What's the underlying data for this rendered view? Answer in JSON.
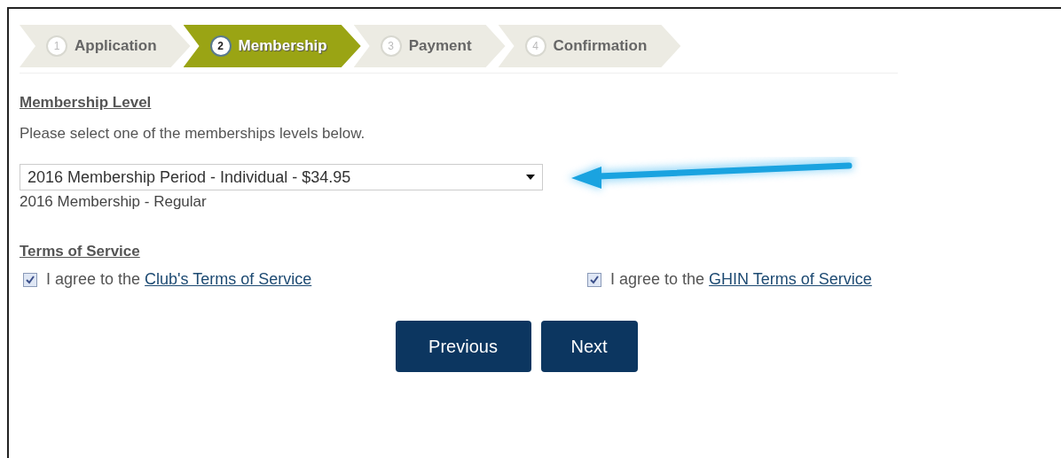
{
  "steps": [
    {
      "number": "1",
      "label": "Application",
      "selected": false
    },
    {
      "number": "2",
      "label": "Membership",
      "selected": true
    },
    {
      "number": "3",
      "label": "Payment",
      "selected": false
    },
    {
      "number": "4",
      "label": "Confirmation",
      "selected": false
    }
  ],
  "membership": {
    "heading": "Membership Level",
    "instruction": "Please select one of the memberships levels below.",
    "select_value": "2016 Membership Period - Individual - $34.95",
    "description": "2016 Membership - Regular"
  },
  "terms": {
    "heading": "Terms of Service",
    "items": [
      {
        "text": "I agree to the",
        "link": "Club's Terms of Service",
        "checked": true
      },
      {
        "text": "I agree to the",
        "link": "GHIN Terms of Service",
        "checked": true
      }
    ]
  },
  "buttons": [
    "Previous",
    "Next"
  ]
}
